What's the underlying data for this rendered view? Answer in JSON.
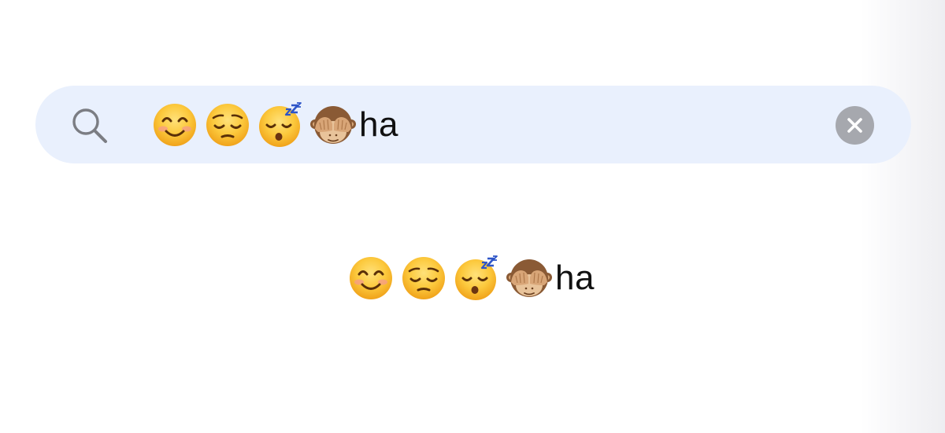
{
  "search": {
    "query_emojis": [
      "smiling-face-with-smiling-eyes",
      "pensive-face",
      "sleeping-face",
      "see-no-evil-monkey"
    ],
    "query_text": "ha"
  },
  "preview": {
    "emojis": [
      "smiling-face-with-smiling-eyes",
      "pensive-face",
      "sleeping-face",
      "see-no-evil-monkey"
    ],
    "text": "ha"
  },
  "icons": {
    "search": "magnifying-glass",
    "clear": "x-circle"
  },
  "colors": {
    "search_field_background": "#e9f0fd",
    "clear_button": "#a6a8ae",
    "search_icon": "#7b7d83",
    "text": "#111111"
  }
}
